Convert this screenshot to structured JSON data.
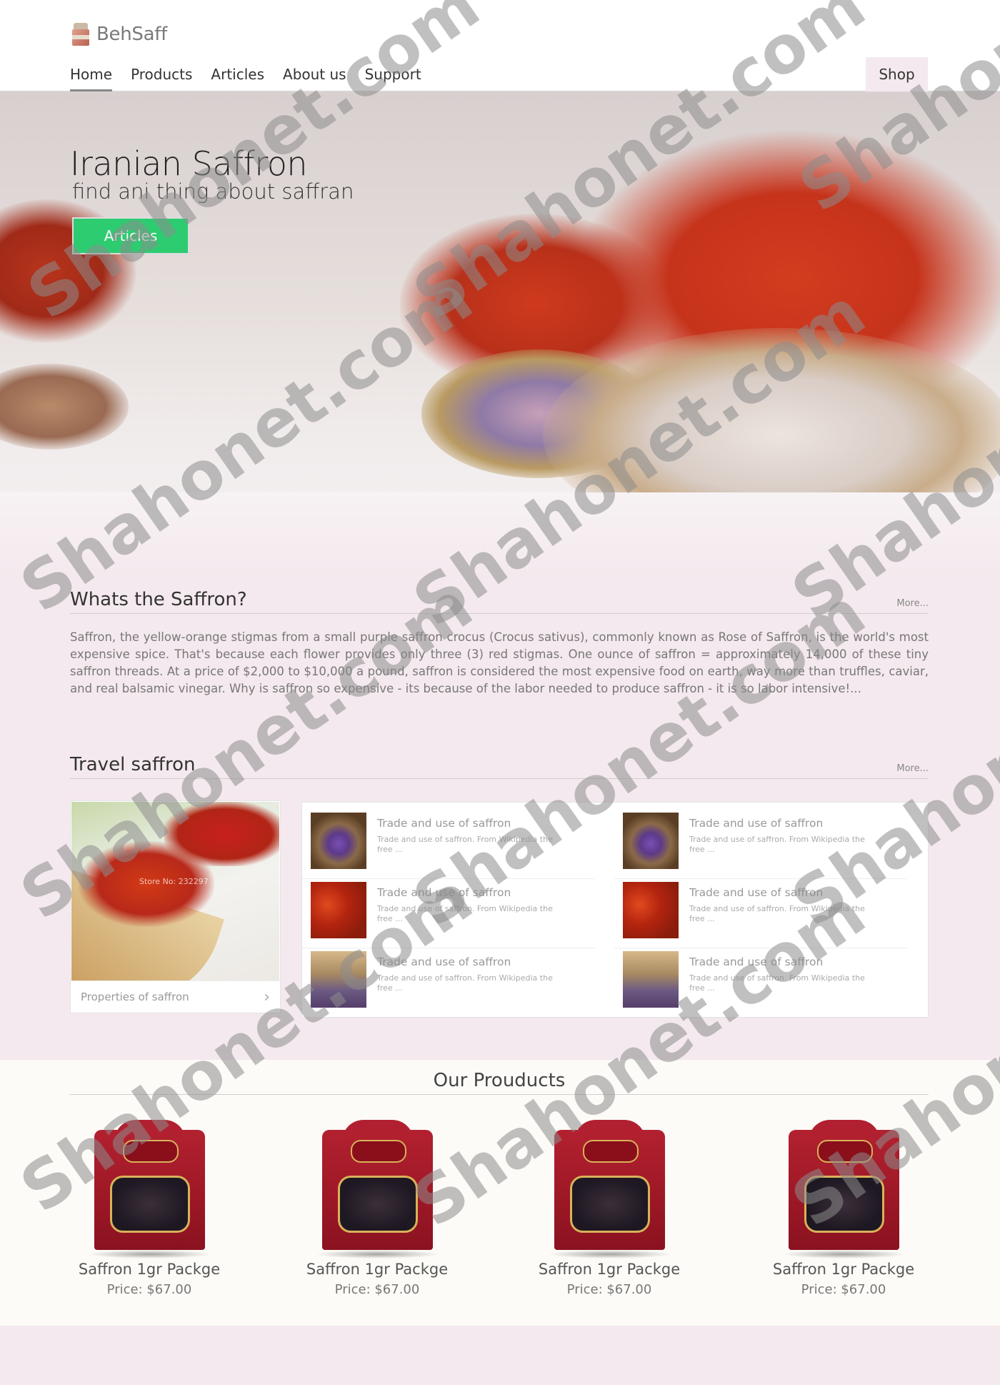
{
  "header": {
    "logo_text": "BehSaff",
    "nav": [
      "Home",
      "Products",
      "Articles",
      "About us",
      "Support"
    ],
    "active_nav": "Home",
    "shop_label": "Shop"
  },
  "hero": {
    "title": "Iranian Saffron",
    "subtitle": "find ani thing about saffran",
    "button_label": "Articles"
  },
  "about": {
    "title": "Whats the Saffron?",
    "more_label": "More...",
    "text": "Saffron, the yellow-orange stigmas from a small purple saffron crocus (Crocus sativus), commonly known as Rose of Saffron, is the world's most expensive spice. That's because each flower provides only three (3) red stigmas. One ounce of saffron = approximately 14,000 of these tiny saffron threads. At a price of $2,000 to $10,000 a pound, saffron is considered the most expensive food on earth, way more than truffles, caviar, and real balsamic vinegar. Why is saffron so expensive - its because of the labor needed to produce saffron - it is so labor intensive!..."
  },
  "travel": {
    "title": "Travel saffron",
    "more_label": "More...",
    "feature": {
      "image_stamp": "Store No: 232297",
      "caption": "Properties of saffron",
      "chevron": "›"
    },
    "items": [
      {
        "title": "Trade and use of saffron",
        "desc": "Trade and use of saffron. From Wikipedia the free ...",
        "thumb": "basket-crocus-image"
      },
      {
        "title": "Trade and use of saffron",
        "desc": "Trade and use of saffron. From Wikipedia the free ...",
        "thumb": "saffron-threads-image"
      },
      {
        "title": "Trade and use of saffron",
        "desc": "Trade and use of saffron. From Wikipedia the free ...",
        "thumb": "saffron-harvest-image"
      },
      {
        "title": "Trade and use of saffron",
        "desc": "Trade and use of saffron. From Wikipedia the free ...",
        "thumb": "basket-crocus-image"
      },
      {
        "title": "Trade and use of saffron",
        "desc": "Trade and use of saffron. From Wikipedia the free ...",
        "thumb": "saffron-threads-image"
      },
      {
        "title": "Trade and use of saffron",
        "desc": "Trade and use of saffron. From Wikipedia the free ...",
        "thumb": "saffron-harvest-image"
      }
    ]
  },
  "products": {
    "title": "Our Prouducts",
    "items": [
      {
        "name": "Saffron 1gr Packge",
        "price": "Price: $67.00"
      },
      {
        "name": "Saffron 1gr Packge",
        "price": "Price: $67.00"
      },
      {
        "name": "Saffron 1gr Packge",
        "price": "Price: $67.00"
      },
      {
        "name": "Saffron 1gr Packge",
        "price": "Price: $67.00"
      }
    ]
  },
  "watermark": "Shahonet.com",
  "colors": {
    "accent_green": "#2ecc71",
    "page_bg": "#f4e9ee",
    "products_bg": "#fcfbf7",
    "saffron_red": "#b8291a"
  }
}
